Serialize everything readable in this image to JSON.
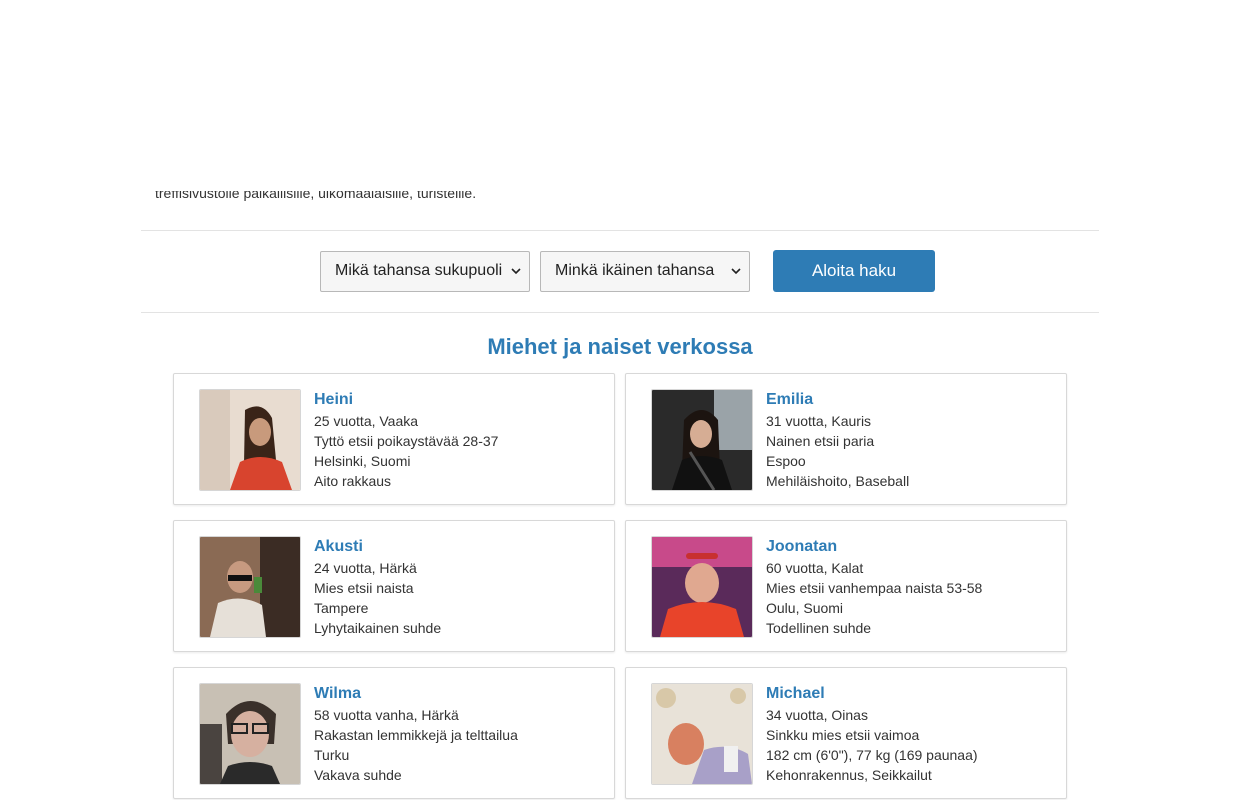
{
  "intro": {
    "text": "treffisivustolle paikallisille, ulkomaalaisille, turisteille."
  },
  "search": {
    "gender_select": {
      "selected": "Mikä tahansa sukupuoli"
    },
    "age_select": {
      "selected": "Minkä ikäinen tahansa"
    },
    "submit_label": "Aloita haku"
  },
  "section": {
    "title": "Miehet ja naiset verkossa"
  },
  "profiles": [
    {
      "name": "Heini",
      "age_sign": "25 vuotta, Vaaka",
      "seeking": "Tyttö etsii poikaystävää 28-37",
      "location": "Helsinki, Suomi",
      "extra": "Aito rakkaus"
    },
    {
      "name": "Emilia",
      "age_sign": "31 vuotta, Kauris",
      "seeking": "Nainen etsii paria",
      "location": "Espoo",
      "extra": "Mehiläishoito, Baseball"
    },
    {
      "name": "Akusti",
      "age_sign": "24 vuotta, Härkä",
      "seeking": "Mies etsii naista",
      "location": "Tampere",
      "extra": "Lyhytaikainen suhde"
    },
    {
      "name": "Joonatan",
      "age_sign": "60 vuotta, Kalat",
      "seeking": "Mies etsii vanhempaa naista 53-58",
      "location": "Oulu, Suomi",
      "extra": "Todellinen suhde"
    },
    {
      "name": "Wilma",
      "age_sign": "58 vuotta vanha, Härkä",
      "seeking": "Rakastan lemmikkejä ja telttailua",
      "location": "Turku",
      "extra": "Vakava suhde"
    },
    {
      "name": "Michael",
      "age_sign": "34 vuotta, Oinas",
      "seeking": "Sinkku mies etsii vaimoa",
      "location": "182 cm (6'0\"), 77 kg (169 paunaa)",
      "extra": "Kehonrakennus, Seikkailut"
    }
  ]
}
